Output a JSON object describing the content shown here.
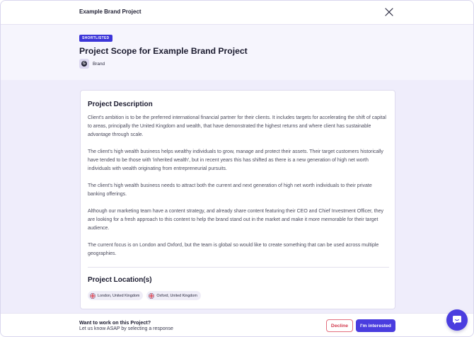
{
  "header": {
    "title": "Example Brand Project"
  },
  "hero": {
    "badge": "SHORTLISTED",
    "title": "Project Scope for Example Brand Project",
    "brand_label": "Brand"
  },
  "description": {
    "heading": "Project Description",
    "paragraphs": [
      "Client's ambition is to be the preferred international financial partner for their clients. It includes targets for accelerating the shift of capital to areas, principally the United Kingdom and wealth, that have demonstrated the highest returns and where client has sustainable advantage through scale.",
      "The client's high wealth business helps wealthy individuals to grow, manage and protect their assets. Their target customers historically have tended to be those with 'inherited wealth', but in recent years this has shifted as there is a new generation of high net worth individuals with wealth originating from entrepreneurial pursuits.",
      "The client's high wealth business needs to attract both the current and next generation of high net worth individuals to their private banking offerings.",
      "Although our marketing team have a content strategy, and already share content featuring their CEO and Chief Investment Officer, they are looking for a fresh approach to this content to help the brand stand out in the market and make it more memorable for their target audience.",
      "The current focus is on London and Oxford, but the team is global so would like to create something that can be used across multiple geographies."
    ]
  },
  "locations": {
    "heading": "Project Location(s)",
    "items": [
      {
        "label": "London, United Kingdom",
        "icon": "uk-flag-icon"
      },
      {
        "label": "Oxford, United Kingdom",
        "icon": "uk-flag-icon"
      }
    ]
  },
  "footer": {
    "question": "Want to work on this Project?",
    "subtext": "Let us know ASAP by selecting a response",
    "decline_label": "Decline",
    "interested_label": "I'm interested"
  },
  "icons": {
    "close": "close-icon",
    "chat": "chat-icon",
    "brand": "brand-logo-icon"
  },
  "colors": {
    "accent": "#4a3ddf",
    "badge": "#3c35d9",
    "decline": "#d2384c",
    "background": "#efedfb"
  }
}
